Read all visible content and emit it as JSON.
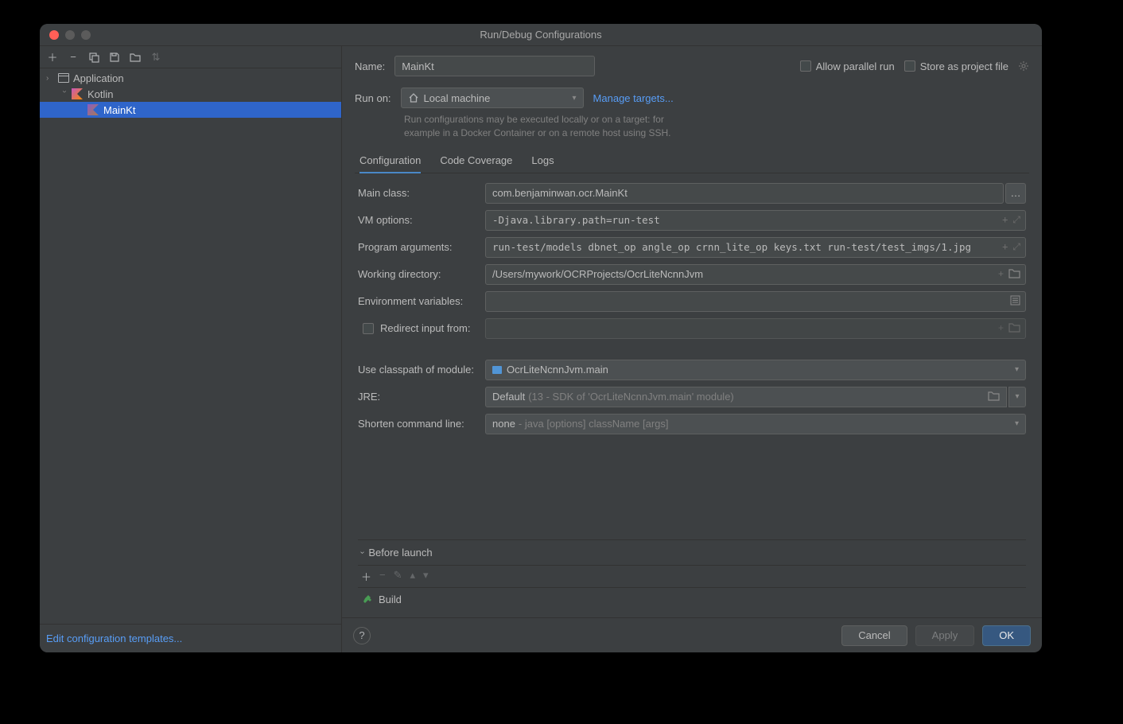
{
  "title": "Run/Debug Configurations",
  "sidebar": {
    "tree": {
      "application": "Application",
      "kotlin": "Kotlin",
      "mainkt": "MainKt"
    },
    "edit_templates": "Edit configuration templates..."
  },
  "header": {
    "name_label": "Name:",
    "name_value": "MainKt",
    "allow_parallel": "Allow parallel run",
    "store_project": "Store as project file"
  },
  "runon": {
    "label": "Run on:",
    "value": "Local machine",
    "manage": "Manage targets...",
    "hint1": "Run configurations may be executed locally or on a target: for",
    "hint2": "example in a Docker Container or on a remote host using SSH."
  },
  "tabs": {
    "configuration": "Configuration",
    "coverage": "Code Coverage",
    "logs": "Logs"
  },
  "form": {
    "main_class_label": "Main class:",
    "main_class_value": "com.benjaminwan.ocr.MainKt",
    "vm_options_label": "VM options:",
    "vm_options_value": "-Djava.library.path=run-test",
    "program_args_label": "Program arguments:",
    "program_args_value": "run-test/models dbnet_op angle_op crnn_lite_op keys.txt run-test/test_imgs/1.jpg",
    "working_dir_label": "Working directory:",
    "working_dir_value": "/Users/mywork/OCRProjects/OcrLiteNcnnJvm",
    "env_vars_label": "Environment variables:",
    "redirect_input": "Redirect input from:",
    "classpath_label": "Use classpath of module:",
    "classpath_value": "OcrLiteNcnnJvm.main",
    "jre_label": "JRE:",
    "jre_value": "Default",
    "jre_hint": "(13 - SDK of 'OcrLiteNcnnJvm.main' module)",
    "shorten_label": "Shorten command line:",
    "shorten_value": "none",
    "shorten_hint": "- java [options] className [args]"
  },
  "before_launch": {
    "title": "Before launch",
    "build": "Build"
  },
  "footer": {
    "cancel": "Cancel",
    "apply": "Apply",
    "ok": "OK"
  }
}
